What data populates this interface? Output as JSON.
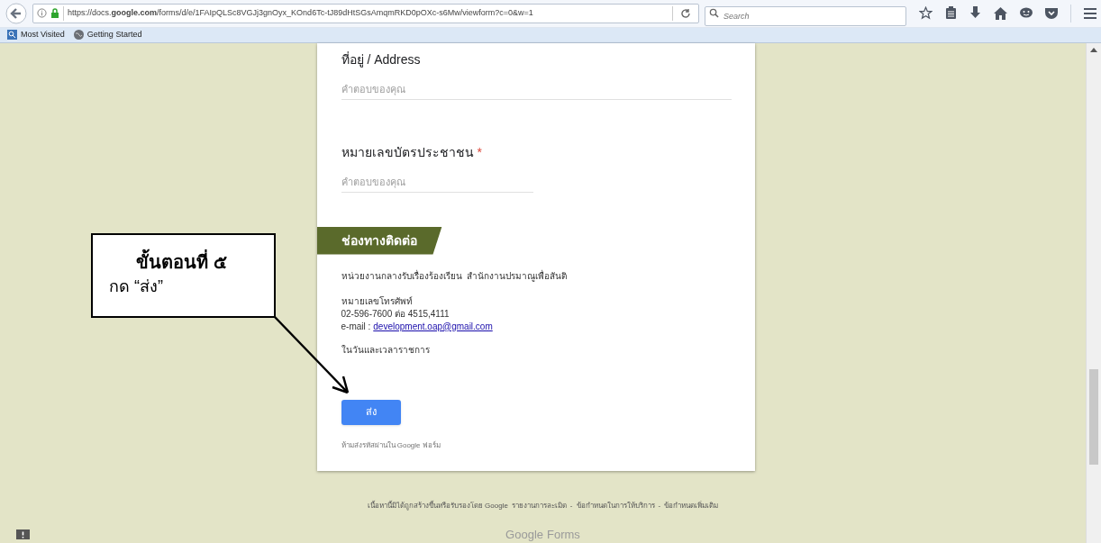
{
  "browser": {
    "url": "https://docs.**google.com**/forms/d/e/1FAIpQLSc8VGJj3gnOyx_KOnd6Tc-tJ89dHtSGsAmqmRKD0pOXc-s6Mw/viewform?c=0&w=1",
    "search": {
      "placeholder": "Search"
    },
    "bookmarks": [
      "Most Visited",
      "Getting Started"
    ]
  },
  "form": {
    "questions": [
      {
        "title": "ที่อยู่ / Address",
        "placeholder": "คำตอบของคุณ",
        "wide": true
      },
      {
        "title": "หมายเลขบัตรประชาชน",
        "required_mark": "*",
        "placeholder": "คำตอบของคุณ",
        "wide": false
      }
    ],
    "section": {
      "title": "ช่องทางติดต่อ",
      "agency": "หน่วยงานกลางรับเรื่องร้องเรียน  สำนักงานปรมาณูเพื่อสันติ",
      "phone_label": "หมายเลขโทรศัพท์",
      "phone": "02-596-7600 ต่อ 4515,4111",
      "email_label": "e-mail :",
      "email": "development.oap@gmail.com",
      "hours": "ในวันและเวลาราชการ"
    },
    "submit": "ส่ง",
    "password_note": "ห้ามส่งรหัสผ่านใน Google ฟอร์ม"
  },
  "footer": {
    "note": "เนื้อหานี้มิได้ถูกสร้างขึ้นหรือรับรองโดย Google",
    "links": [
      "รายงานการละเมิด",
      "ข้อกำหนดในการให้บริการ",
      "ข้อกำหนดเพิ่มเติม"
    ],
    "separator": "-",
    "brand": "Google",
    "product": "Forms"
  },
  "callout": {
    "title": "ขั้นตอนที่ ๕",
    "text": "กด “ส่ง”"
  }
}
